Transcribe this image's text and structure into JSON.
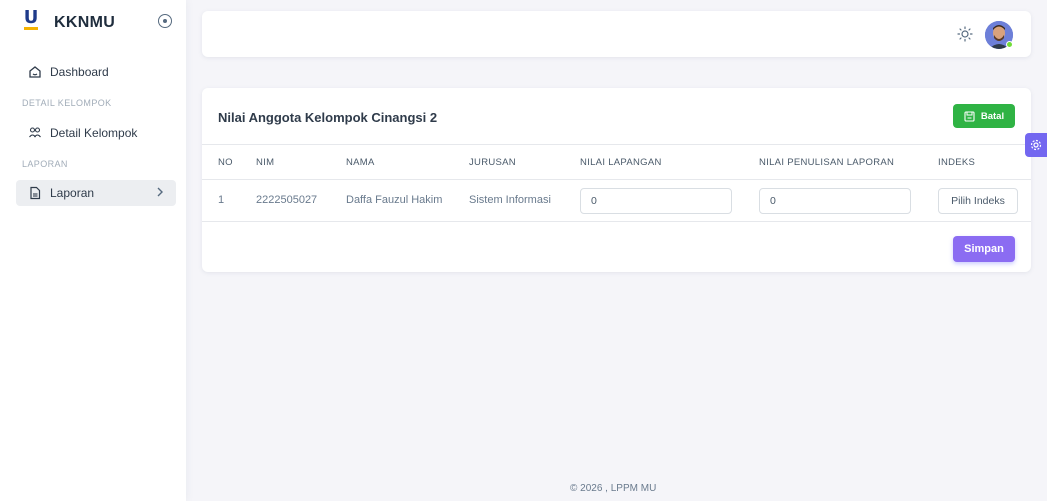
{
  "sidebar": {
    "brand": "KKNMU",
    "menu": {
      "dashboard": "Dashboard",
      "header_detail": "DETAIL KELOMPOK",
      "detail_kelompok": "Detail Kelompok",
      "header_laporan": "LAPORAN",
      "laporan": "Laporan"
    }
  },
  "card": {
    "title": "Nilai Anggota Kelompok Cinangsi 2",
    "batal_label": "Batal",
    "simpan_label": "Simpan",
    "columns": [
      "NO",
      "NIM",
      "NAMA",
      "JURUSAN",
      "NILAI LAPANGAN",
      "NILAI PENULISAN LAPORAN",
      "INDEKS"
    ],
    "rows": [
      {
        "no": "1",
        "nim": "2222505027",
        "nama": "Daffa Fauzul Hakim",
        "jurusan": "Sistem Informasi",
        "nilai_lapangan": "0",
        "nilai_penulisan": "0",
        "indeks": "Pilih Indeks"
      }
    ]
  },
  "footer": "© 2026 , LPPM MU",
  "colors": {
    "accent": "#8b6cf2",
    "batal": "#2fb344",
    "customizer": "#7367f0",
    "online": "#71dd37"
  },
  "icons": {
    "theme": "sun-icon",
    "dashboard": "home-icon",
    "detail": "users-icon",
    "laporan": "file-icon",
    "customizer": "gear-icon"
  }
}
